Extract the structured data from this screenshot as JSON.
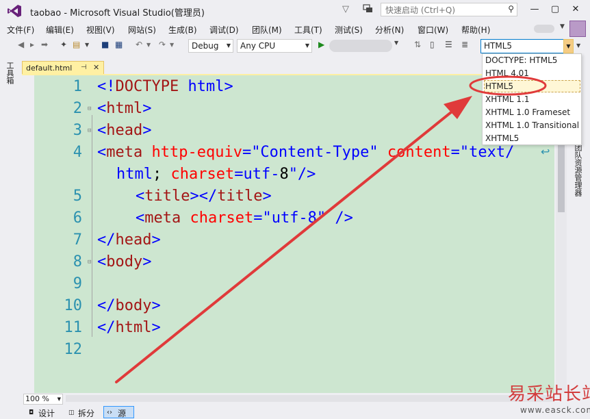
{
  "window": {
    "title": "taobao - Microsoft Visual Studio(管理员)",
    "quick_launch_placeholder": "快速启动 (Ctrl+Q)",
    "controls": [
      "—",
      "▢",
      "✕"
    ]
  },
  "menu": [
    "文件(F)",
    "编辑(E)",
    "视图(V)",
    "网站(S)",
    "生成(B)",
    "调试(D)",
    "团队(M)",
    "工具(T)",
    "测试(S)",
    "分析(N)",
    "窗口(W)",
    "帮助(H)"
  ],
  "toolbar": {
    "config": "Debug",
    "platform": "Any CPU",
    "doctype_value": "HTML5"
  },
  "side_panels": {
    "toolbox": "工具箱",
    "team_explorer": "团队资源管理器"
  },
  "document_tab": {
    "name": "default.html",
    "pin": "⊣",
    "close": "✕"
  },
  "code_lines": [
    {
      "num": "1",
      "text": "<!DOCTYPE html>"
    },
    {
      "num": "2",
      "text": "<html>"
    },
    {
      "num": "3",
      "text": "<head>"
    },
    {
      "num": "4",
      "text": "<meta http-equiv=\"Content-Type\" content=\"text/"
    },
    {
      "num": "",
      "text": "html; charset=utf-8\"/>"
    },
    {
      "num": "5",
      "text": "<title></title>"
    },
    {
      "num": "6",
      "text": "<meta charset=\"utf-8\" />"
    },
    {
      "num": "7",
      "text": "</head>"
    },
    {
      "num": "8",
      "text": "<body>"
    },
    {
      "num": "9",
      "text": ""
    },
    {
      "num": "10",
      "text": "</body>"
    },
    {
      "num": "11",
      "text": "</html>"
    },
    {
      "num": "12",
      "text": ""
    }
  ],
  "doctype_options": [
    "DOCTYPE: HTML5",
    "HTML 4.01",
    "HTML5",
    "XHTML 1.1",
    "XHTML 1.0 Frameset",
    "XHTML 1.0 Transitional",
    "XHTML5"
  ],
  "doctype_selected": "HTML5",
  "zoom": "100 %",
  "view_buttons": {
    "design": "设计",
    "split": "拆分",
    "source": "源"
  },
  "watermark": {
    "text": "易采站长站",
    "url": "www.easck.com"
  },
  "colors": {
    "editor_bg": "#cde6d0",
    "annotation": "#e03a3a",
    "accent": "#007acc"
  }
}
